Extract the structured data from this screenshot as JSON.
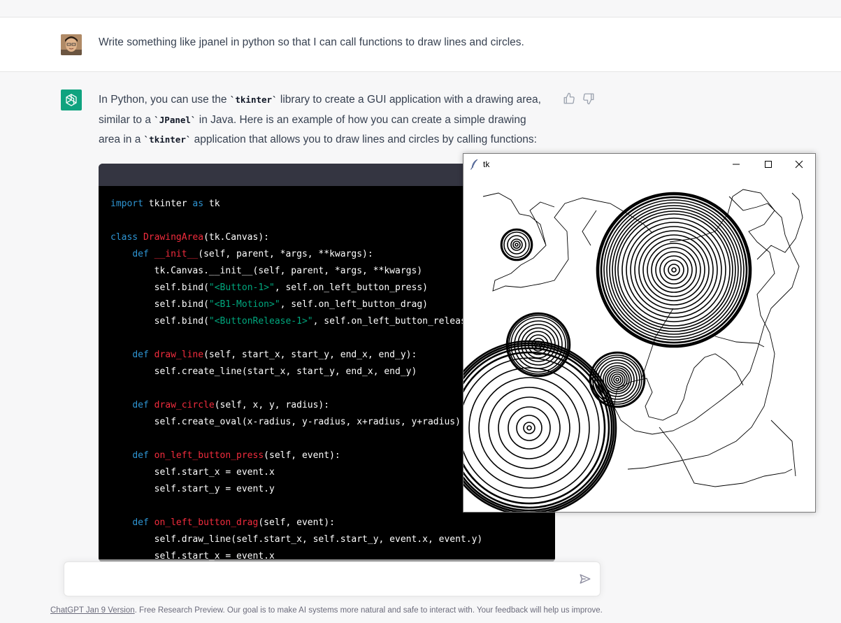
{
  "user_message": {
    "text": "Write something like jpanel in python so that I can call functions to draw lines and circles.",
    "avatar_icon": "user-avatar"
  },
  "assistant": {
    "line1_pre": "In Python, you can use the ",
    "line1_code": "`tkinter`",
    "line1_post": " library to create a GUI application with a drawing area,",
    "line2_pre": "similar to a ",
    "line2_code": "`JPanel`",
    "line2_post": " in Java. Here is an example of how you can create a simple drawing",
    "line3_pre": "area in a ",
    "line3_code": "`tkinter`",
    "line3_post": " application that allows you to draw lines and circles by calling functions:"
  },
  "code": {
    "l1_kw": "import",
    "l1_mid": " tkinter ",
    "l1_kw2": "as",
    "l1_end": " tk",
    "l2_kw": "class",
    "l2_fn": "DrawingArea",
    "l2_end": "(tk.Canvas):",
    "l3_kw": "def",
    "l3_fn": "__init__",
    "l3_end": "(self, parent, *args, **kwargs):",
    "l4": "tk.Canvas.__init__(self, parent, *args, **kwargs)",
    "l5_pre": "self.bind(",
    "l5_str": "\"<Button-1>\"",
    "l5_post": ", self.on_left_button_press)",
    "l6_pre": "self.bind(",
    "l6_str": "\"<B1-Motion>\"",
    "l6_post": ", self.on_left_button_drag)",
    "l7_pre": "self.bind(",
    "l7_str": "\"<ButtonRelease-1>\"",
    "l7_post": ", self.on_left_button_release)",
    "l8_kw": "def",
    "l8_fn": "draw_line",
    "l8_end": "(self, start_x, start_y, end_x, end_y):",
    "l9": "self.create_line(start_x, start_y, end_x, end_y)",
    "l10_kw": "def",
    "l10_fn": "draw_circle",
    "l10_end": "(self, x, y, radius):",
    "l11": "self.create_oval(x-radius, y-radius, x+radius, y+radius)",
    "l12_kw": "def",
    "l12_fn": "on_left_button_press",
    "l12_end": "(self, event):",
    "l13": "self.start_x = event.x",
    "l14": "self.start_y = event.y",
    "l15_kw": "def",
    "l15_fn": "on_left_button_drag",
    "l15_end": "(self, event):",
    "l16": "self.draw_line(self.start_x, self.start_y, event.x, event.y)",
    "l17": "self.start_x = event.x"
  },
  "tk_window": {
    "title": "tk",
    "minimize_icon": "minimize-icon",
    "maximize_icon": "maximize-icon",
    "close_icon": "close-icon"
  },
  "input": {
    "value": "",
    "placeholder": ""
  },
  "footer": {
    "link": "ChatGPT Jan 9 Version",
    "text": ". Free Research Preview. Our goal is to make AI systems more natural and safe to interact with. Your feedback will help us improve."
  },
  "colors": {
    "brand": "#10a37f",
    "keyword": "#2e95d3",
    "function": "#f22c3d",
    "string": "#00a67d"
  }
}
